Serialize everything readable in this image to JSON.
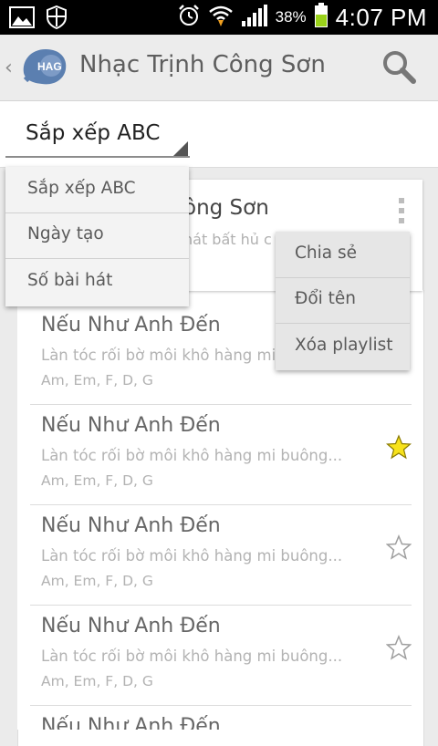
{
  "status_bar": {
    "time": "4:07 PM",
    "battery_percent": "38%",
    "icons": [
      "gallery-icon",
      "shield-icon",
      "alarm-icon",
      "wifi-icon",
      "signal-icon",
      "battery-icon"
    ]
  },
  "action_bar": {
    "title": "Nhạc Trịnh Công Sơn",
    "logo_text": "HAG",
    "icons": [
      "back-chevron-icon",
      "app-logo-icon",
      "search-icon"
    ]
  },
  "sort": {
    "selected": "Sắp xếp ABC",
    "options": [
      "Sắp xếp ABC",
      "Ngày tạo",
      "Số bài hát"
    ]
  },
  "playlist": {
    "title_visible": "ông Sơn",
    "description_visible": "hát bất hủ c"
  },
  "overflow_menu": {
    "items": [
      "Chia sẻ",
      "Đổi tên",
      "Xóa playlist"
    ]
  },
  "songs": [
    {
      "title": "Nếu Như Anh Đến",
      "lyric": "Làn tóc rối bờ môi khô hàng mi buông...",
      "chords": "Am, Em, F, D, G",
      "starred": false
    },
    {
      "title": "Nếu Như Anh Đến",
      "lyric": "Làn tóc rối bờ môi khô hàng mi buông...",
      "chords": "Am, Em, F, D, G",
      "starred": true
    },
    {
      "title": "Nếu Như Anh Đến",
      "lyric": "Làn tóc rối bờ môi khô hàng mi buông...",
      "chords": "Am, Em, F, D, G",
      "starred": false
    },
    {
      "title": "Nếu Như Anh Đến",
      "lyric": "Làn tóc rối bờ môi khô hàng mi buông...",
      "chords": "Am, Em, F, D, G",
      "starred": false
    },
    {
      "title": "Nếu Như Anh Đến",
      "lyric": "",
      "chords": "",
      "starred": false
    }
  ],
  "colors": {
    "star_filled": "#f7e21b",
    "star_outline": "#9e9e9e",
    "logo_blue": "#5b7fb0",
    "battery_green": "#9ad21a",
    "download_orange": "#f0a020"
  }
}
